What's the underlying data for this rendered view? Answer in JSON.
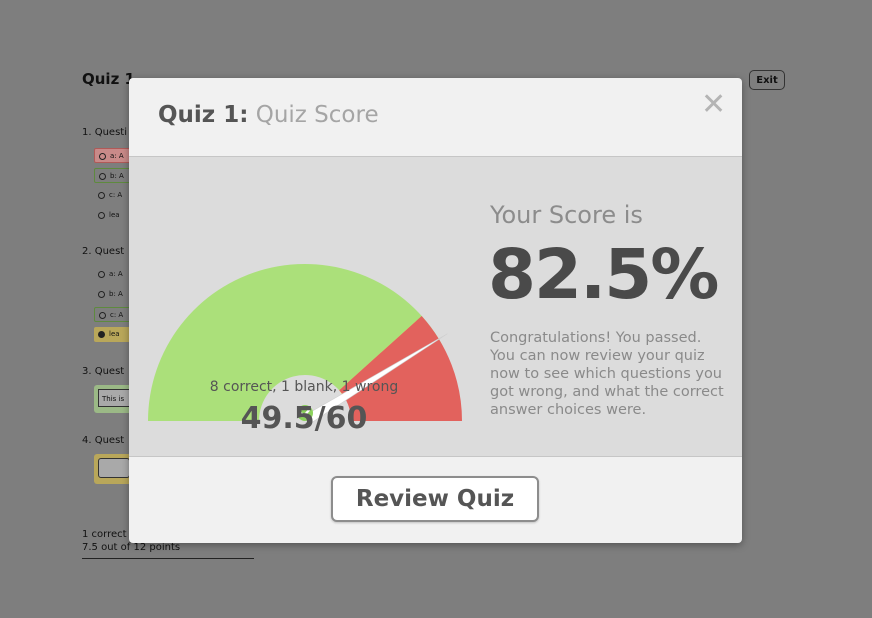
{
  "background": {
    "title": "Quiz 1",
    "exit_label": "Exit",
    "questions": [
      {
        "label": "1. Questi",
        "options": [
          {
            "label": "a: A",
            "state": "wrong"
          },
          {
            "label": "b: A",
            "state": "correct"
          },
          {
            "label": "c: A",
            "state": "none"
          },
          {
            "label": "lea",
            "state": "none"
          }
        ]
      },
      {
        "label": "2. Quest",
        "options": [
          {
            "label": "a: A",
            "state": "none"
          },
          {
            "label": "b: A",
            "state": "none"
          },
          {
            "label": "c: A",
            "state": "correct"
          },
          {
            "label": "lea",
            "state": "blank"
          }
        ]
      },
      {
        "label": "3. Quest",
        "answer": "This is"
      },
      {
        "label": "4. Quest",
        "answer": ""
      }
    ],
    "footer_line1": "1 correct",
    "footer_line2": "7.5 out of 12 points"
  },
  "modal": {
    "title_strong": "Quiz 1:",
    "title_light": "Quiz Score",
    "close_icon": "close-icon",
    "gauge": {
      "score_fraction": 0.825,
      "colors": {
        "green": "#abe07a",
        "yellow": "#f5e872",
        "red": "#e2625d",
        "needle": "#ffffff",
        "check": "#8bd15c"
      }
    },
    "summary": "8 correct, 1 blank, 1 wrong",
    "points": "49.5/60",
    "score_label": "Your Score is",
    "score_value": "82.5%",
    "congrats": "Congratulations! You passed. You can now review your quiz now to see which questions you got wrong, and what the correct answer choices were.",
    "review_button": "Review Quiz"
  }
}
